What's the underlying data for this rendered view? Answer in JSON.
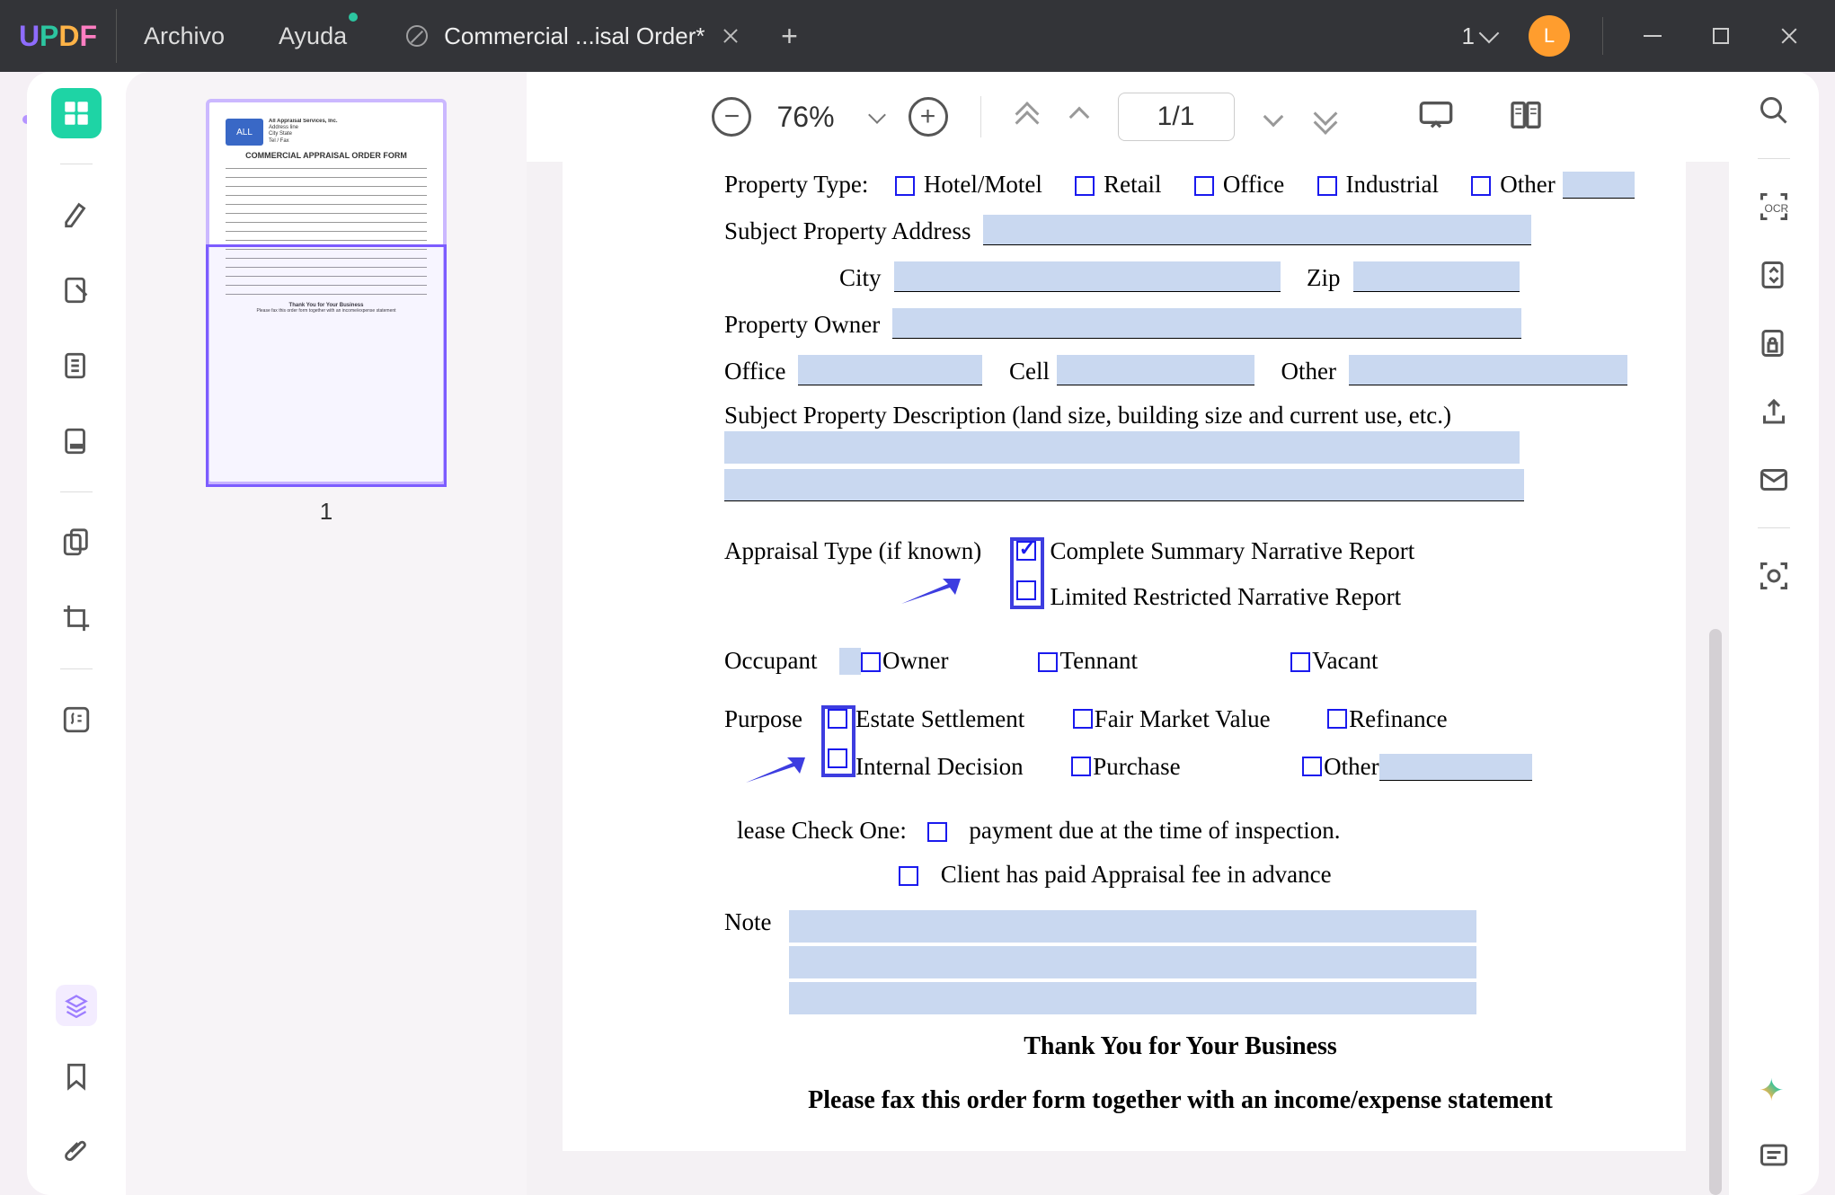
{
  "app": {
    "logo": "UPDF",
    "menu_file": "Archivo",
    "menu_help": "Ayuda"
  },
  "tab": {
    "title": "Commercial ...isal Order*",
    "modified": true
  },
  "window": {
    "tab_count": "1",
    "avatar_letter": "L"
  },
  "toolbar": {
    "zoom": "76%",
    "page_current": "1",
    "page_sep": " / ",
    "page_total": "1"
  },
  "thumbnail": {
    "page_label": "1",
    "doc_title": "COMMERCIAL APPRAISAL ORDER FORM",
    "company": "All Appraisal Services, Inc."
  },
  "form": {
    "property_type_label": "Property Type:",
    "pt_hotel": "Hotel/Motel",
    "pt_retail": "Retail",
    "pt_office": "Office",
    "pt_industrial": "Industrial",
    "pt_other": "Other",
    "subject_addr": "Subject Property Address",
    "city": "City",
    "zip": "Zip",
    "owner": "Property Owner",
    "office": "Office",
    "cell": "Cell",
    "other_phone": "Other",
    "desc": "Subject Property Description (land size, building size and current use, etc.)",
    "appraisal_type": "Appraisal Type (if known)",
    "at_complete": "Complete Summary Narrative Report",
    "at_limited": "Limited Restricted Narrative Report",
    "occupant": "Occupant",
    "oc_owner": "Owner",
    "oc_tennant": "Tennant",
    "oc_vacant": "Vacant",
    "purpose": "Purpose",
    "p_estate": "Estate Settlement",
    "p_fmv": "Fair Market Value",
    "p_refi": "Refinance",
    "p_internal": "Internal Decision",
    "p_purchase": "Purchase",
    "p_other": "Other",
    "check_one": "lease Check One:",
    "pay_due": "payment due at the time of inspection.",
    "pay_advance": "Client has paid Appraisal fee in advance",
    "note": "Note",
    "thank": "Thank You for Your Business",
    "please": "Please fax this order form together with an income/expense statement"
  }
}
